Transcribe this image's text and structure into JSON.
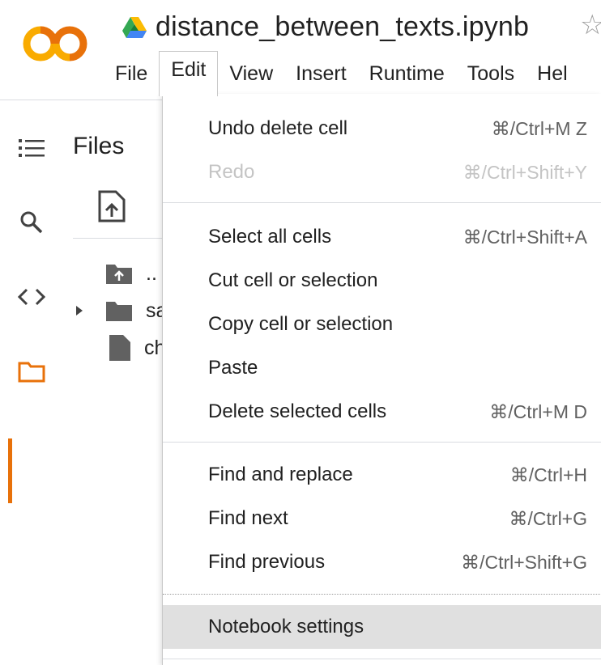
{
  "app": {
    "notebook_title": "distance_between_texts.ipynb"
  },
  "menubar": {
    "items": [
      {
        "label": "File"
      },
      {
        "label": "Edit"
      },
      {
        "label": "View"
      },
      {
        "label": "Insert"
      },
      {
        "label": "Runtime"
      },
      {
        "label": "Tools"
      },
      {
        "label": "Hel"
      }
    ],
    "active": "Edit"
  },
  "sidebar": {
    "panel_title": "Files",
    "files": [
      {
        "name": "..",
        "icon": "folder-up-icon"
      },
      {
        "name": "sa",
        "icon": "folder-icon"
      },
      {
        "name": "ch",
        "icon": "file-icon"
      }
    ]
  },
  "edit_menu": {
    "groups": [
      [
        {
          "label": "Undo delete cell",
          "shortcut": "⌘/Ctrl+M Z",
          "enabled": true
        },
        {
          "label": "Redo",
          "shortcut": "⌘/Ctrl+Shift+Y",
          "enabled": false
        }
      ],
      [
        {
          "label": "Select all cells",
          "shortcut": "⌘/Ctrl+Shift+A",
          "enabled": true
        },
        {
          "label": "Cut cell or selection",
          "shortcut": "",
          "enabled": true
        },
        {
          "label": "Copy cell or selection",
          "shortcut": "",
          "enabled": true
        },
        {
          "label": "Paste",
          "shortcut": "",
          "enabled": true
        },
        {
          "label": "Delete selected cells",
          "shortcut": "⌘/Ctrl+M D",
          "enabled": true
        }
      ],
      [
        {
          "label": "Find and replace",
          "shortcut": "⌘/Ctrl+H",
          "enabled": true
        },
        {
          "label": "Find next",
          "shortcut": "⌘/Ctrl+G",
          "enabled": true
        },
        {
          "label": "Find previous",
          "shortcut": "⌘/Ctrl+Shift+G",
          "enabled": true
        }
      ],
      [
        {
          "label": "Notebook settings",
          "shortcut": "",
          "enabled": true,
          "highlighted": true
        }
      ]
    ]
  },
  "colors": {
    "accent": "#e8710a",
    "logo_yellow": "#f9ab00",
    "logo_orange": "#e8710a",
    "hover_bg": "#e0e0e0",
    "disabled_text": "#c4c4c4"
  }
}
